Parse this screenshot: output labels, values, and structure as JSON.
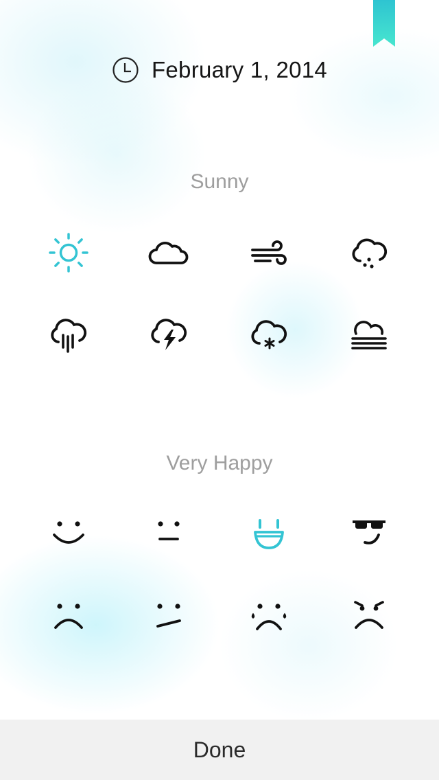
{
  "header": {
    "date": "February 1, 2014",
    "icon": "clock-icon"
  },
  "weather": {
    "selected_label": "Sunny",
    "icons": [
      "sun-icon",
      "cloud-icon",
      "wind-icon",
      "drizzle-icon",
      "rain-icon",
      "thunderstorm-icon",
      "snow-icon",
      "fog-icon"
    ],
    "selected_index": 0
  },
  "mood": {
    "selected_label": "Very Happy",
    "icons": [
      "smile-icon",
      "neutral-face-icon",
      "very-happy-face-icon",
      "cool-face-icon",
      "sad-face-icon",
      "skeptical-face-icon",
      "crying-face-icon",
      "angry-face-icon"
    ],
    "selected_index": 2
  },
  "footer": {
    "done_label": "Done"
  },
  "colors": {
    "accent": "#33c4d3",
    "ink": "#111111",
    "label": "#9e9e9e",
    "footer_bg": "#f1f1f1"
  }
}
